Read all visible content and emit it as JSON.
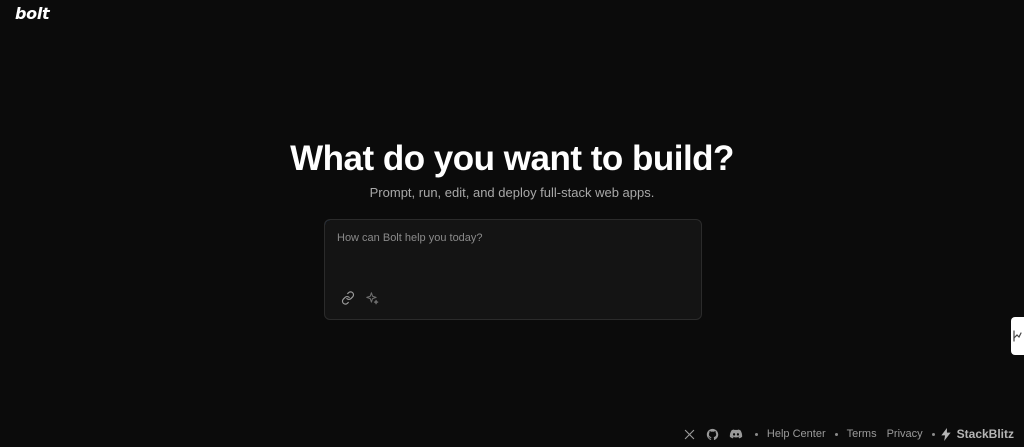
{
  "header": {
    "logo_text": "bolt"
  },
  "hero": {
    "title": "What do you want to build?",
    "subtitle": "Prompt, run, edit, and deploy full-stack web apps."
  },
  "prompt": {
    "placeholder": "How can Bolt help you today?",
    "value": "",
    "icons": [
      "link-icon",
      "sparkles-icon"
    ]
  },
  "footer": {
    "social_icons": [
      "x-icon",
      "github-icon",
      "discord-icon"
    ],
    "help_center": "Help Center",
    "terms": "Terms",
    "privacy": "Privacy",
    "brand": "StackBlitz",
    "brand_icon": "lightning-bolt-icon"
  },
  "colors": {
    "background": "#0b0b0b",
    "input_background": "#141414",
    "input_border": "#2b2b2b",
    "accent_glow": "#2f6fc4",
    "muted_text": "#9a9a9a"
  }
}
